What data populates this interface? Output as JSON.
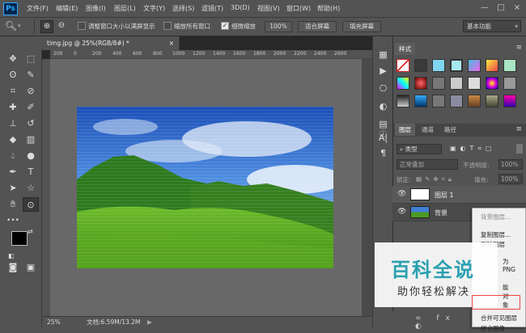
{
  "app": {
    "logo": "Ps"
  },
  "menu": [
    "文件(F)",
    "编辑(E)",
    "图像(I)",
    "图层(L)",
    "文字(Y)",
    "选择(S)",
    "滤镜(T)",
    "3D(D)",
    "视图(V)",
    "窗口(W)",
    "帮助(H)"
  ],
  "window_controls": {
    "minimize": "—",
    "restore": "□",
    "close": "×"
  },
  "options_bar": {
    "resize_windows_label": "调整窗口大小以满屏显示",
    "zoom_all_label": "缩放所有窗口",
    "scrubby_zoom_label": "细微缩放",
    "btn_100": "100%",
    "fit_screen": "适合屏幕",
    "fill_screen": "填充屏幕",
    "workspace": "基本功能"
  },
  "document": {
    "tab_title": "timg.jpg @ 25%(RGB/8#) *",
    "tab_close": "×",
    "ruler_marks": [
      "200",
      "0",
      "200",
      "400",
      "600",
      "800",
      "1000",
      "1200",
      "1400",
      "1600",
      "1800",
      "2000",
      "2200",
      "2400",
      "2600"
    ],
    "zoom": "25%",
    "doc_info": "文档:6.59M/13.2M"
  },
  "styles_panel": {
    "title": "样式"
  },
  "layers_panel": {
    "tabs": [
      "图层",
      "通道",
      "路径"
    ],
    "filter_kind": "类型",
    "blend_mode": "正常叠加",
    "opacity_label": "不透明度:",
    "opacity_value": "100%",
    "lock_label": "锁定:",
    "fill_label": "填充:",
    "fill_value": "100%",
    "layers": [
      {
        "name": "图层 1"
      },
      {
        "name": "背景"
      }
    ]
  },
  "context_menu": {
    "items": [
      "背景图层...",
      "复制图层...",
      "删除图层",
      "转换为 PNG",
      "转换为智能对象",
      "合并可见图层",
      "拼合图像"
    ],
    "partial_1": "为 PNG",
    "partial_2": "能对象"
  },
  "watermark": {
    "title": "百科全说",
    "subtitle": "助你轻松解决"
  },
  "colors": {
    "ps_blue": "#31a8ff",
    "panel_bg": "#535353",
    "canvas_gray": "#686868"
  }
}
